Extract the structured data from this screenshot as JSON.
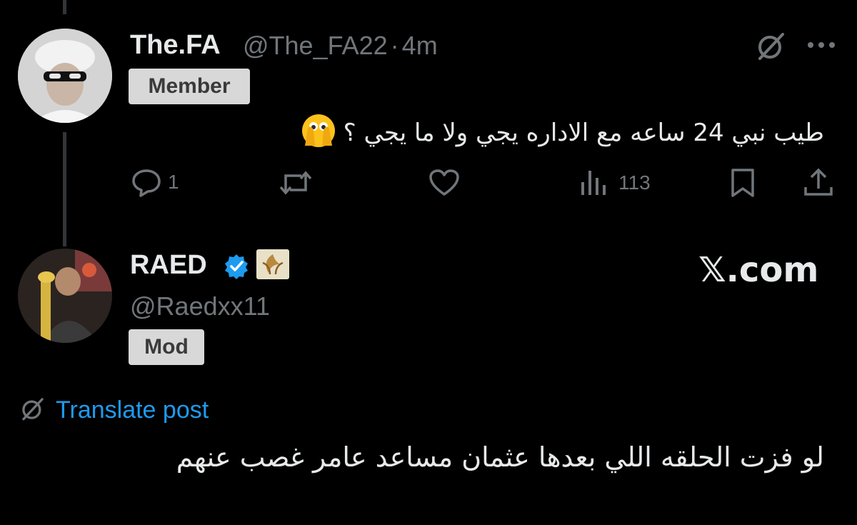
{
  "post1": {
    "display_name": "The.FA",
    "handle": "@The_FA22",
    "separator": "·",
    "time": "4m",
    "badge": "Member",
    "text": "طيب نبي 24 ساعه مع الاداره يجي ولا ما يجي ؟",
    "emoji": "face-with-open-eyes-and-hand-over-mouth",
    "actions": {
      "replies": "1",
      "views": "113"
    }
  },
  "post2": {
    "display_name": "RAED",
    "handle": "@Raedxx11",
    "badge": "Mod",
    "translate_label": "Translate post",
    "text": "لو فزت الحلقه اللي بعدها عثمان مساعد عامر غصب عنهم"
  },
  "watermark": "𝕏.com",
  "colors": {
    "background": "#000000",
    "text": "#e7e9ea",
    "muted": "#71767b",
    "link": "#1d9bf0",
    "verified": "#1d9bf0",
    "badge_bg": "#d8d8d8"
  }
}
